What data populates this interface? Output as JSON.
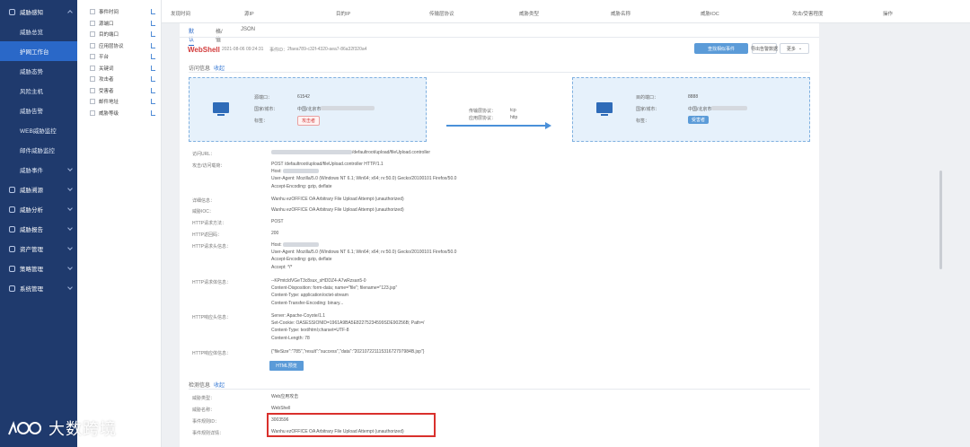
{
  "nav": {
    "items": [
      {
        "label": "威胁感知",
        "type": "group"
      },
      {
        "label": "威胁总览",
        "type": "sub"
      },
      {
        "label": "护网工作台",
        "type": "sub-active"
      },
      {
        "label": "威胁态势",
        "type": "sub"
      },
      {
        "label": "风险主机",
        "type": "sub"
      },
      {
        "label": "威胁告警",
        "type": "sub"
      },
      {
        "label": "WEB威胁监控",
        "type": "sub"
      },
      {
        "label": "邮件威胁监控",
        "type": "sub"
      },
      {
        "label": "威胁事件",
        "type": "sub-chev"
      },
      {
        "label": "威胁溯源",
        "type": "group"
      },
      {
        "label": "威胁分析",
        "type": "group"
      },
      {
        "label": "威胁报告",
        "type": "group"
      },
      {
        "label": "资产管理",
        "type": "group"
      },
      {
        "label": "策略管理",
        "type": "group"
      },
      {
        "label": "系统管理",
        "type": "group"
      }
    ]
  },
  "list": {
    "items": [
      "事件时间",
      "源端口",
      "目的端口",
      "应用层协议",
      "平台",
      "关键词",
      "攻击者",
      "受害者",
      "邮件地址",
      "威胁等级"
    ]
  },
  "table_header": {
    "columns": [
      "发现时间",
      "源IP",
      "目的IP",
      "传输层协议",
      "威胁类型",
      "威胁名称",
      "威胁IOC",
      "攻击/受害程度",
      "操作"
    ]
  },
  "detail": {
    "tabs": [
      "默认",
      "格/值",
      "JSON"
    ],
    "title": "WebShell",
    "timestamp": "2021-08-06 09:24:31",
    "event_id_label": "事件ID：",
    "event_id": "2faea789-c32f-4320-aea7-86a32f320a4",
    "buttons": {
      "primary": "查找相似事件",
      "secondary": "导出告警数据",
      "more": "更多"
    },
    "access_section": {
      "title": "访问信息",
      "collapse": "收起"
    },
    "source_node": {
      "port_label": "源端口：",
      "port": "61542",
      "location_label": "国家/城市：",
      "location": "中国/北京市",
      "tag_label": "标签：",
      "tag": "攻击者"
    },
    "dest_node": {
      "port_label": "目的端口：",
      "port": "8888",
      "location_label": "国家/城市：",
      "location": "中国/北京市",
      "tag_label": "标签：",
      "tag": "受害者"
    },
    "protocol": {
      "transport_label": "传输层协议：",
      "transport": "tcp",
      "app_label": "应用层协议：",
      "app": "http"
    },
    "fields": [
      {
        "label": "访问URL：",
        "lines": [
          "/defaultroot/upload/fileUpload.controller"
        ]
      },
      {
        "label": "攻击/访问载荷：",
        "lines": [
          "POST /defaultroot/upload/fileUpload.controller HTTP/1.1",
          "Host: ",
          "User-Agent: Mozilla/5.0 (Windows NT 6.1; Win64; x64; rv:50.0) Gecko/20100101 Firefox/50.0",
          "Accept-Encoding: gzip, deflate"
        ]
      },
      {
        "label": "详细信息：",
        "lines": [
          "Wanhu ezOFFICE OA Arbitrary File Upload Attempt (unauthorized)"
        ]
      },
      {
        "label": "威胁IOC：",
        "lines": [
          "Wanhu ezOFFICE OA Arbitrary File Upload Attempt (unauthorized)"
        ]
      },
      {
        "label": "HTTP请求方法：",
        "lines": [
          "POST"
        ]
      },
      {
        "label": "HTTP返回码：",
        "lines": [
          "200"
        ]
      },
      {
        "label": "HTTP请求头信息：",
        "lines": [
          "Host: ",
          "User-Agent: Mozilla/5.0 (Windows NT 6.1; Win64; x64; rv:50.0) Gecko/20100101 Firefox/50.0",
          "Accept-Encoding: gzip, deflate",
          "Accept: */*"
        ]
      },
      {
        "label": "HTTP请求体信息：",
        "lines": [
          "--KPmtcldVGeT3c8sux_sHDDZ4-A7wRzsan5-0",
          "Content-Disposition: form-data; name=\"file\"; filename=\"123.jsp\"",
          "Content-Type: application/octet-stream",
          "Content-Transfer-Encoding: binary..."
        ]
      },
      {
        "label": "HTTP响应头信息：",
        "lines": [
          "Server: Apache-Coyote/1.1",
          "Set-Cookie: OASESSIONID=1961A9BA5E82275234599SDE90256B; Path=/",
          "Content-Type: text/html;charset=UTF-8",
          "Content-Length: 78"
        ]
      },
      {
        "label": "HTTP响应体信息：",
        "lines": [
          "{\"fileSize\":\"785\",\"result\":\"success\",\"data\":\"20210722111531672797984B.jsp\"}"
        ]
      }
    ],
    "html_button": "HTML预览",
    "detect_section": {
      "title": "检测信息",
      "collapse": "收起"
    },
    "detect_fields": [
      {
        "label": "威胁类型：",
        "value": "Web应用攻击"
      },
      {
        "label": "威胁名称：",
        "value": "WebShell"
      },
      {
        "label": "事件规则ID：",
        "value": "3003596"
      },
      {
        "label": "事件规则详情：",
        "value": "Wanhu ezOFFICE OA Arbitrary File Upload Attempt (unauthorized)"
      }
    ]
  },
  "watermark": {
    "text": "大数跨境"
  },
  "colors": {
    "nav_bg": "#1f3a6d",
    "nav_active": "#2a68c8",
    "title_red": "#d23a3a",
    "highlight": "#d9302c",
    "accent_blue": "#5b9bd8"
  }
}
